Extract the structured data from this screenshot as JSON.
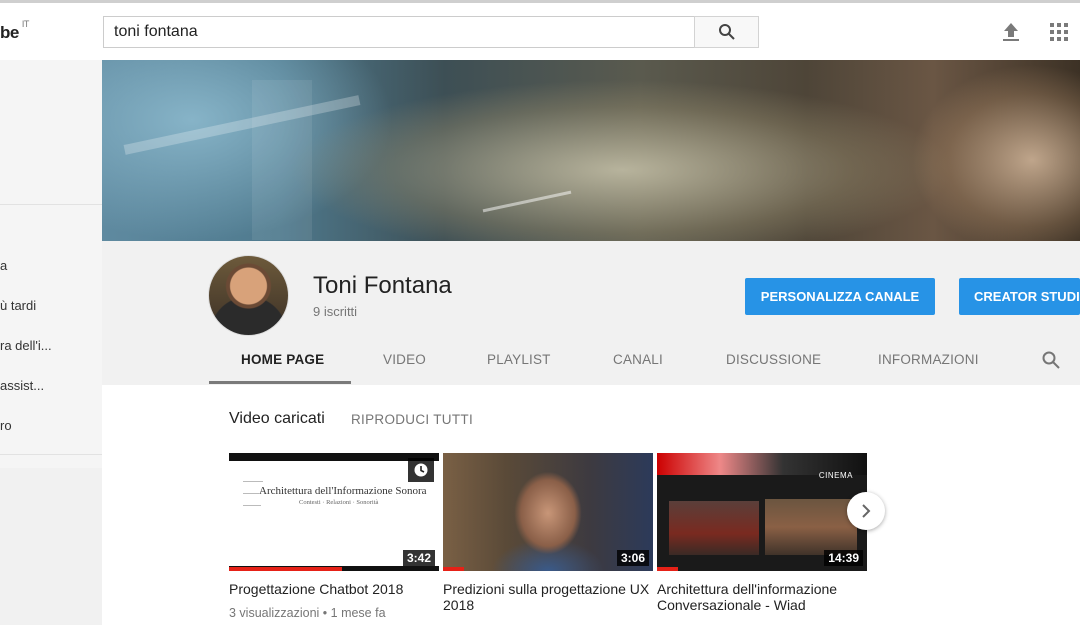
{
  "masthead": {
    "logo_text": "be",
    "logo_region": "IT",
    "search_value": "toni fontana",
    "icons": [
      "search-icon",
      "upload-icon",
      "apps-icon"
    ]
  },
  "sidebar": {
    "items": [
      {
        "label": "a"
      },
      {
        "label": "ù tardi"
      },
      {
        "label": "ra dell'i..."
      },
      {
        "label": " assist..."
      },
      {
        "label": "ro"
      }
    ]
  },
  "channel": {
    "name": "Toni Fontana",
    "subscribers": "9 iscritti",
    "customize_label": "PERSONALIZZA CANALE",
    "creator_label": "CREATOR STUDIO"
  },
  "tabs": [
    {
      "label": "HOME PAGE",
      "active": true
    },
    {
      "label": "VIDEO"
    },
    {
      "label": "PLAYLIST"
    },
    {
      "label": "CANALI"
    },
    {
      "label": "DISCUSSIONE"
    },
    {
      "label": "INFORMAZIONI"
    }
  ],
  "section": {
    "title": "Video caricati",
    "play_all": "RIPRODUCI TUTTI"
  },
  "videos": [
    {
      "thumb_title": "Architettura dell'Informazione Sonora",
      "thumb_subtitle": "Contesti · Relazioni · Sonorità",
      "duration": "3:42",
      "title": "Progettazione Chatbot 2018",
      "meta": "3 visualizzazioni • 1 mese fa",
      "watched_fraction": 0.54
    },
    {
      "duration": "3:06",
      "title": "Predizioni sulla progettazione UX 2018",
      "watched_fraction": 0.1
    },
    {
      "thumb_label": "CINEMA",
      "duration": "14:39",
      "title": "Architettura dell'informazione Conversazionale - Wiad",
      "watched_fraction": 0.1
    }
  ],
  "colors": {
    "accent_blue": "#2793e6",
    "progress_red": "#e62117"
  }
}
